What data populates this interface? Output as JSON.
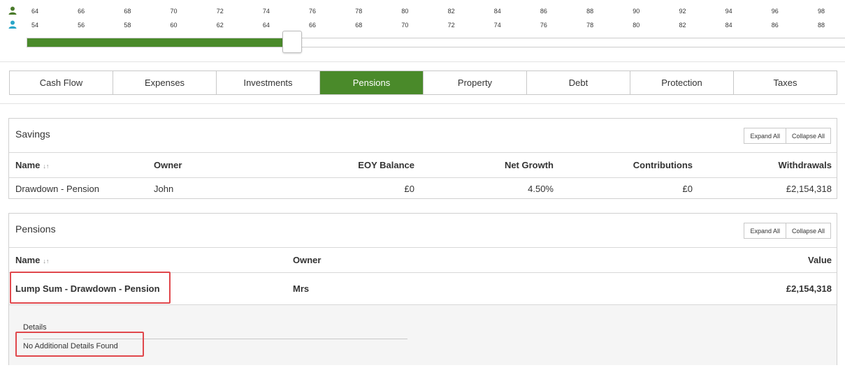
{
  "timeline": {
    "person1_ages": [
      "64",
      "66",
      "68",
      "70",
      "72",
      "74",
      "76",
      "78",
      "80",
      "82",
      "84",
      "86",
      "88",
      "90",
      "92",
      "94",
      "96",
      "98"
    ],
    "person2_ages": [
      "54",
      "56",
      "58",
      "60",
      "62",
      "64",
      "66",
      "68",
      "70",
      "72",
      "74",
      "76",
      "78",
      "80",
      "82",
      "84",
      "86",
      "88"
    ],
    "person1_icon_color": "#4a7a2a",
    "person2_icon_color": "#2aa6c9",
    "slider_progress_fraction": 0.316,
    "fill_color": "#4a8a2a"
  },
  "tabs": [
    {
      "label": "Cash Flow",
      "active": false
    },
    {
      "label": "Expenses",
      "active": false
    },
    {
      "label": "Investments",
      "active": false
    },
    {
      "label": "Pensions",
      "active": true
    },
    {
      "label": "Property",
      "active": false
    },
    {
      "label": "Debt",
      "active": false
    },
    {
      "label": "Protection",
      "active": false
    },
    {
      "label": "Taxes",
      "active": false
    }
  ],
  "savings": {
    "title": "Savings",
    "expand_all": "Expand All",
    "collapse_all": "Collapse All",
    "columns": {
      "name": "Name",
      "owner": "Owner",
      "eoy_balance": "EOY Balance",
      "net_growth": "Net Growth",
      "contributions": "Contributions",
      "withdrawals": "Withdrawals"
    },
    "rows": [
      {
        "name": "Drawdown - Pension",
        "owner": "John",
        "eoy_balance": "£0",
        "net_growth": "4.50%",
        "contributions": "£0",
        "withdrawals": "£2,154,318"
      }
    ]
  },
  "pensions": {
    "title": "Pensions",
    "expand_all": "Expand All",
    "collapse_all": "Collapse All",
    "columns": {
      "name": "Name",
      "owner": "Owner",
      "value": "Value"
    },
    "rows": [
      {
        "name": "Lump Sum - Drawdown - Pension",
        "owner": "Mrs",
        "value": "£2,154,318"
      }
    ],
    "details_label": "Details",
    "details_empty": "No Additional Details Found"
  },
  "highlight_color": "#e0474c"
}
